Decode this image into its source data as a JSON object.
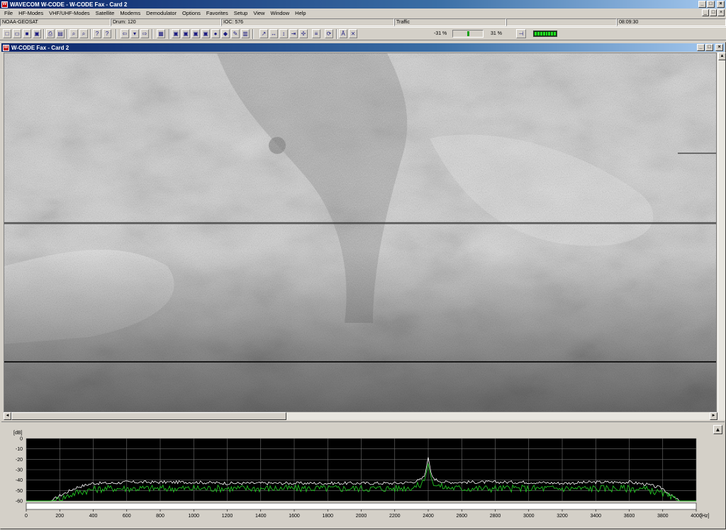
{
  "app": {
    "title": "WAVECOM W-CODE - W-CODE Fax  - Card 2",
    "icon_text": "W",
    "win_minimize": "_",
    "win_maximize": "□",
    "win_close": "×"
  },
  "menu": [
    "File",
    "HF-Modes",
    "VHF/UHF-Modes",
    "Satellite",
    "Modems",
    "Demodulator",
    "Options",
    "Favorites",
    "Setup",
    "View",
    "Window",
    "Help"
  ],
  "status": {
    "mode": "NOAA-GEOSAT",
    "drum": "Drum: 120",
    "ioc": "IOC: 576",
    "state": "Traffic",
    "time": "08:09:30"
  },
  "toolbar": {
    "level_left": "-31 %",
    "level_right": "31 %",
    "level_value": 0.5,
    "icons": [
      "new-icon",
      "open-icon",
      "save-icon",
      "save-as-icon",
      "print-icon",
      "print-preview-icon",
      "find-icon",
      "find-next-icon",
      "help-icon",
      "context-help-icon",
      "back-icon",
      "dropdown-icon",
      "forward-icon",
      "table-icon",
      "mode1-icon",
      "mode2-icon",
      "mode3-icon",
      "mode4-icon",
      "record-icon",
      "stop-icon",
      "tune-icon",
      "afc-icon",
      "sync-icon",
      "phase-icon",
      "invert-icon",
      "center-icon",
      "lock-icon",
      "refresh-icon",
      "fm-icon",
      "auto-icon",
      "tuning-indicator-icon"
    ],
    "led_count": 8
  },
  "child": {
    "title": "W-CODE Fax  - Card 2",
    "scroll_up": "▲",
    "scroll_down": "▼",
    "scroll_left": "◄",
    "scroll_right": "►"
  },
  "spectrum": {
    "collapse_label": "▲",
    "y_unit": "[dB]",
    "x_unit": "[Hz]",
    "colors": {
      "background": "#000000",
      "grid": "#707070",
      "peak_trace": "#ffffff",
      "avg_trace": "#22c022",
      "slider": "#ffffff"
    }
  },
  "chart_data": {
    "type": "line",
    "title": "",
    "xlabel": "[Hz]",
    "ylabel": "[dB]",
    "xlim": [
      0,
      4000
    ],
    "ylim": [
      -60,
      0
    ],
    "x_ticks": [
      0,
      200,
      400,
      600,
      800,
      1000,
      1200,
      1400,
      1600,
      1800,
      2000,
      2200,
      2400,
      2600,
      2800,
      3000,
      3200,
      3400,
      3600,
      3800,
      4000
    ],
    "y_ticks": [
      0,
      -10,
      -20,
      -30,
      -40,
      -50,
      -60
    ],
    "grid": true,
    "series": [
      {
        "color": "#ffffff",
        "x": [
          0,
          150,
          200,
          300,
          400,
          500,
          600,
          800,
          1000,
          1200,
          1400,
          1600,
          1800,
          2000,
          2200,
          2300,
          2350,
          2380,
          2400,
          2420,
          2450,
          2500,
          2600,
          2800,
          3000,
          3200,
          3400,
          3600,
          3700,
          3800,
          3860,
          3900,
          4000
        ],
        "y": [
          -60,
          -60,
          -55,
          -47,
          -43,
          -43,
          -42,
          -42,
          -42,
          -43,
          -43,
          -43,
          -43,
          -43,
          -43,
          -42,
          -40,
          -36,
          -18,
          -36,
          -40,
          -42,
          -42,
          -42,
          -42,
          -43,
          -42,
          -42,
          -44,
          -48,
          -56,
          -60,
          -60
        ]
      },
      {
        "color": "#22c022",
        "x": [
          0,
          150,
          200,
          300,
          400,
          500,
          600,
          800,
          1000,
          1200,
          1400,
          1600,
          1800,
          2000,
          2200,
          2300,
          2350,
          2380,
          2400,
          2420,
          2450,
          2500,
          2600,
          2800,
          3000,
          3200,
          3400,
          3600,
          3700,
          3800,
          3860,
          3900,
          4000
        ],
        "y": [
          -60,
          -60,
          -58,
          -52,
          -49,
          -48,
          -48,
          -48,
          -48,
          -48,
          -48,
          -48,
          -48,
          -48,
          -48,
          -47,
          -45,
          -40,
          -24,
          -40,
          -45,
          -47,
          -48,
          -48,
          -48,
          -48,
          -48,
          -48,
          -49,
          -53,
          -58,
          -60,
          -60
        ]
      }
    ]
  }
}
